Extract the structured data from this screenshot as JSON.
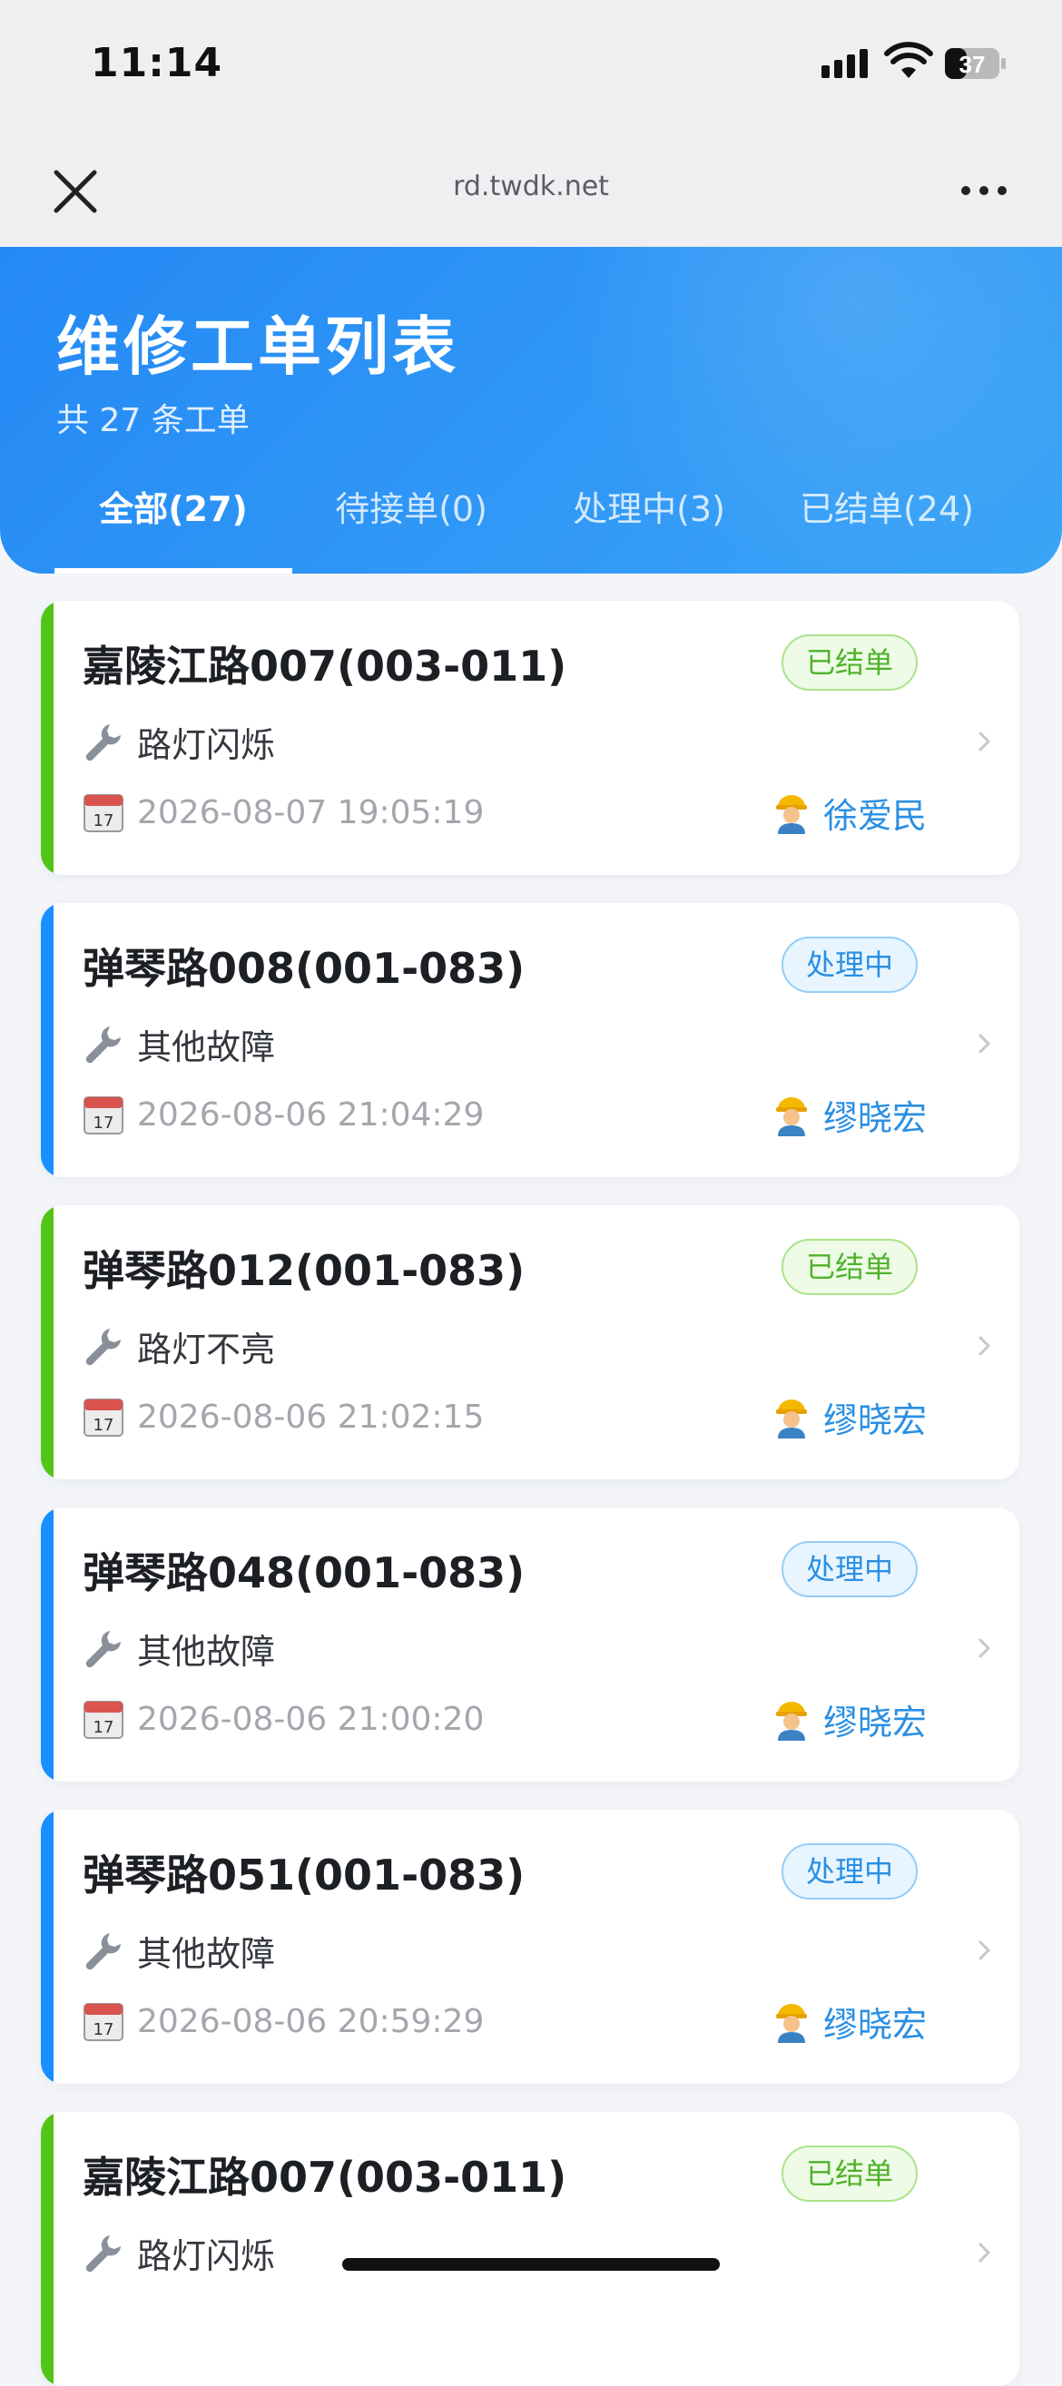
{
  "status_bar": {
    "time": "11:14",
    "battery": "37"
  },
  "browser": {
    "url": "rd.twdk.net"
  },
  "header": {
    "title": "维修工单列表",
    "subtitle": "共 27 条工单"
  },
  "tabs": [
    {
      "label": "全部(27)",
      "active": true
    },
    {
      "label": "待接单(0)",
      "active": false
    },
    {
      "label": "处理中(3)",
      "active": false
    },
    {
      "label": "已结单(24)",
      "active": false
    }
  ],
  "colors": {
    "accent": "#2a8fe3",
    "done": "#52c41a",
    "processing": "#1890ff"
  },
  "orders": [
    {
      "title": "嘉陵江路007(003-011)",
      "status": "已结单",
      "status_type": "done",
      "fault": "路灯闪烁",
      "date": "2026-08-07 19:05:19",
      "worker": "徐爱民"
    },
    {
      "title": "弹琴路008(001-083)",
      "status": "处理中",
      "status_type": "proc",
      "fault": "其他故障",
      "date": "2026-08-06 21:04:29",
      "worker": "缪晓宏"
    },
    {
      "title": "弹琴路012(001-083)",
      "status": "已结单",
      "status_type": "done",
      "fault": "路灯不亮",
      "date": "2026-08-06 21:02:15",
      "worker": "缪晓宏"
    },
    {
      "title": "弹琴路048(001-083)",
      "status": "处理中",
      "status_type": "proc",
      "fault": "其他故障",
      "date": "2026-08-06 21:00:20",
      "worker": "缪晓宏"
    },
    {
      "title": "弹琴路051(001-083)",
      "status": "处理中",
      "status_type": "proc",
      "fault": "其他故障",
      "date": "2026-08-06 20:59:29",
      "worker": "缪晓宏"
    },
    {
      "title": "嘉陵江路007(003-011)",
      "status": "已结单",
      "status_type": "done",
      "fault": "路灯闪烁",
      "date": "",
      "worker": ""
    }
  ]
}
